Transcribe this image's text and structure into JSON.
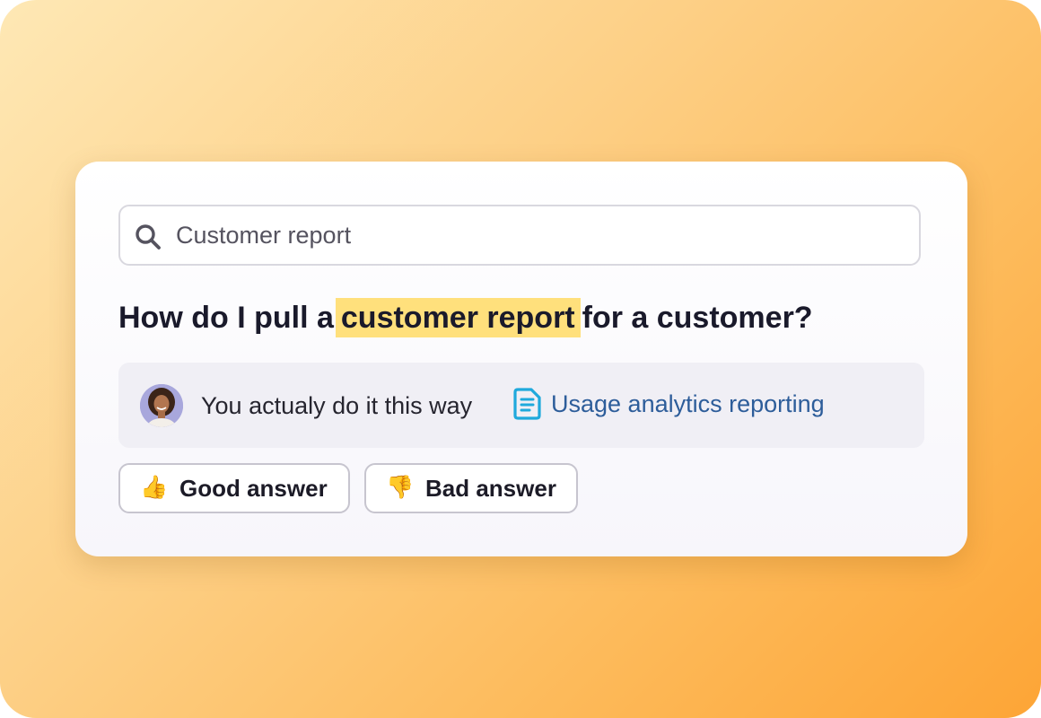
{
  "search": {
    "value": "Customer report",
    "icon": "search-icon"
  },
  "question": {
    "before": "How do I pull a",
    "highlight": "customer report",
    "after": "for a customer?",
    "highlight_color": "#ffe07c"
  },
  "answer": {
    "text": "You actualy do it this way",
    "link_label": "Usage analytics reporting",
    "link_icon": "document-icon",
    "link_color": "#2d5d9a",
    "avatar": "user-avatar"
  },
  "feedback": {
    "good": {
      "emoji": "👍",
      "label": "Good answer",
      "icon": "thumbs-up-icon"
    },
    "bad": {
      "emoji": "👎",
      "label": "Bad answer",
      "icon": "thumbs-down-icon"
    }
  },
  "colors": {
    "background_gradient": [
      "#fee8b5",
      "#fda536"
    ],
    "card": "#ffffff",
    "answer_box": "#f0eff5"
  }
}
